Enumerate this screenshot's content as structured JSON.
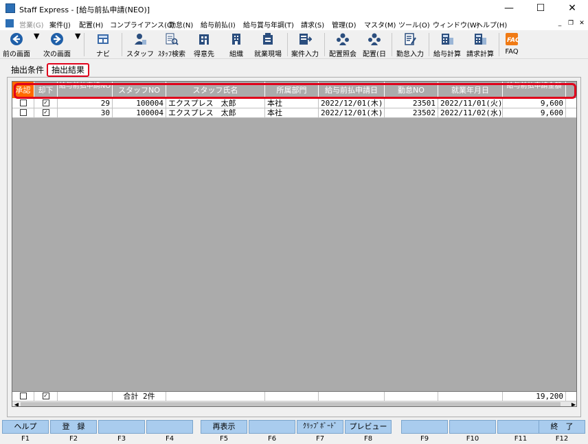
{
  "window": {
    "title": "Staff Express - [給与前払申請(NEO)]",
    "controls": {
      "minimize": "—",
      "maximize": "☐",
      "close": "✕"
    }
  },
  "menubar": {
    "items": [
      {
        "label": "営業(G)",
        "disabled": true
      },
      {
        "label": "案件(J)"
      },
      {
        "label": "配置(H)"
      },
      {
        "label": "コンプライアンス(C)"
      },
      {
        "label": "勤怠(N)"
      },
      {
        "label": "給与前払(I)"
      },
      {
        "label": "給与賞与年調(T)"
      },
      {
        "label": "請求(S)"
      },
      {
        "label": "管理(D)"
      },
      {
        "label": "マスタ(M)"
      },
      {
        "label": "ツール(O)"
      },
      {
        "label": "ウィンドウ(W)"
      },
      {
        "label": "ヘルプ(H)"
      }
    ],
    "mdi": {
      "minimize": "_",
      "restore": "❐",
      "close": "✕"
    }
  },
  "toolbar": {
    "buttons": [
      {
        "label": "前の画面",
        "icon": "arrow-left-icon"
      },
      {
        "label": "次の画面",
        "icon": "arrow-right-icon"
      },
      {
        "label": "ナビ",
        "icon": "navi-icon"
      },
      {
        "label": "スタッフ",
        "icon": "staff-icon"
      },
      {
        "label": "ｽﾀｯﾌ検索",
        "icon": "staff-search-icon"
      },
      {
        "label": "得意先",
        "icon": "customer-icon"
      },
      {
        "label": "組織",
        "icon": "organization-icon"
      },
      {
        "label": "就業現場",
        "icon": "workplace-icon"
      },
      {
        "label": "案件入力",
        "icon": "job-entry-icon"
      },
      {
        "label": "配置照会",
        "icon": "placement-inquiry-icon"
      },
      {
        "label": "配置(日",
        "icon": "placement-daily-icon"
      },
      {
        "label": "勤怠入力",
        "icon": "attendance-entry-icon"
      },
      {
        "label": "給与計算",
        "icon": "payroll-icon"
      },
      {
        "label": "請求計算",
        "icon": "billing-icon"
      },
      {
        "label": "FAQ",
        "icon": "faq-icon"
      }
    ]
  },
  "tabs": {
    "conditions": "抽出条件",
    "results": "抽出結果"
  },
  "grid": {
    "columns": [
      "承認",
      "却下",
      "給与前払申請NO",
      "スタッフNO",
      "スタッフ氏名",
      "所属部門",
      "給与前払申請日",
      "勤怠NO",
      "就業年月日",
      "給与前払申請金額"
    ],
    "rows": [
      {
        "approve": false,
        "reject": true,
        "request_no": "29",
        "staff_no": "100004",
        "staff_name": "エクスプレス　太郎",
        "dept": "本社",
        "request_date": "2022/12/01(木)",
        "attendance_no": "23501",
        "work_date": "2022/11/01(火)",
        "amount": "9,600"
      },
      {
        "approve": false,
        "reject": true,
        "request_no": "30",
        "staff_no": "100004",
        "staff_name": "エクスプレス　太郎",
        "dept": "本社",
        "request_date": "2022/12/01(木)",
        "attendance_no": "23502",
        "work_date": "2022/11/02(水)",
        "amount": "9,600"
      }
    ],
    "totals": {
      "approve": false,
      "reject": true,
      "count_label": "合計 2件",
      "amount": "19,200"
    }
  },
  "fkeys": [
    {
      "label": "ヘルプ",
      "key": "F1"
    },
    {
      "label": "登　録",
      "key": "F2"
    },
    {
      "label": "",
      "key": "F3"
    },
    {
      "label": "",
      "key": "F4"
    },
    {
      "label": "再表示",
      "key": "F5"
    },
    {
      "label": "",
      "key": "F6"
    },
    {
      "label": "ｸﾘｯﾌﾟﾎﾞｰﾄﾞ",
      "key": "F7"
    },
    {
      "label": "プレビュー",
      "key": "F8"
    },
    {
      "label": "",
      "key": "F9"
    },
    {
      "label": "",
      "key": "F10"
    },
    {
      "label": "",
      "key": "F11"
    },
    {
      "label": "終　了",
      "key": "F12"
    }
  ],
  "colors": {
    "accent_red": "#e0001b",
    "approve_header": "#ff6a00",
    "fkey_bg": "#a9ccee",
    "grid_bg": "#ababab"
  }
}
